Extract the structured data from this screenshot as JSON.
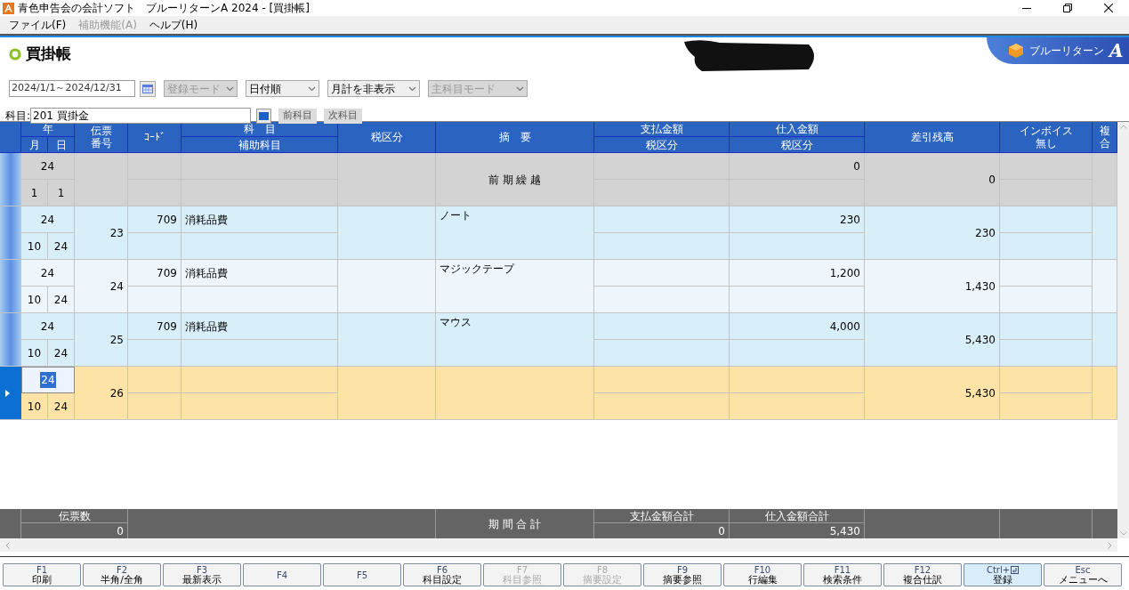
{
  "window": {
    "title": "青色申告会の会計ソフト　ブルーリターンA 2024 - [買掛帳]"
  },
  "menu": [
    {
      "label": "ファイル(F)",
      "disabled": false
    },
    {
      "label": "補助機能(A)",
      "disabled": true
    },
    {
      "label": "ヘルプ(H)",
      "disabled": false
    }
  ],
  "page": {
    "title": "買掛帳"
  },
  "brand": {
    "name": "ブルーリターン",
    "mark": "A"
  },
  "filters": {
    "period": "2024/1/1～2024/12/31",
    "dropdowns": [
      {
        "value": "登録モード",
        "disabled": true
      },
      {
        "value": "日付順",
        "disabled": false
      },
      {
        "value": "月計を非表示",
        "disabled": false
      },
      {
        "value": "主科目モード",
        "disabled": true
      }
    ]
  },
  "account": {
    "label": "科目:",
    "value": "201 買掛金",
    "buttons": [
      "前科目",
      "次科目"
    ]
  },
  "table": {
    "headers": {
      "year": "年",
      "month": "月",
      "day": "日",
      "voucher": [
        "伝票",
        "番号"
      ],
      "code": "ｺｰﾄﾞ",
      "account": "科　目",
      "sub_account": "補助科目",
      "tax": "税区分",
      "memo": "摘　要",
      "payment": "支払金額",
      "payment_tax": "税区分",
      "purchase": "仕入金額",
      "purchase_tax": "税区分",
      "balance": "差引残高",
      "invoice": [
        "インボイス",
        "無し"
      ],
      "compound": [
        "複",
        "合"
      ]
    },
    "rows": [
      {
        "kind": "opening",
        "selected": false,
        "year": "24",
        "month": "1",
        "day": "1",
        "memo": "前 期 繰 越",
        "purchase": "0",
        "balance": "0"
      },
      {
        "kind": "entry",
        "selected": false,
        "year": "24",
        "month": "10",
        "day": "24",
        "voucher": "23",
        "code": "709",
        "account": "消耗品費",
        "memo": "ノート",
        "purchase": "230",
        "balance": "230"
      },
      {
        "kind": "entry",
        "selected": false,
        "year": "24",
        "month": "10",
        "day": "24",
        "voucher": "24",
        "code": "709",
        "account": "消耗品費",
        "memo": "マジックテープ",
        "purchase": "1,200",
        "balance": "1,430"
      },
      {
        "kind": "entry",
        "selected": false,
        "year": "24",
        "month": "10",
        "day": "24",
        "voucher": "25",
        "code": "709",
        "account": "消耗品費",
        "memo": "マウス",
        "purchase": "4,000",
        "balance": "5,430"
      },
      {
        "kind": "new",
        "selected": true,
        "year": "24",
        "month": "10",
        "day": "24",
        "voucher": "26",
        "balance": "5,430"
      }
    ],
    "totals": {
      "count_label": "伝票数",
      "count": "0",
      "period_label": "期 間 合 計",
      "payment_label": "支払金額合計",
      "payment": "0",
      "purchase_label": "仕入金額合計",
      "purchase": "5,430"
    }
  },
  "function_keys": [
    {
      "key": "F1",
      "label": "印刷",
      "disabled": false,
      "highlighted": false
    },
    {
      "key": "F2",
      "label": "半角/全角",
      "disabled": false,
      "highlighted": false
    },
    {
      "key": "F3",
      "label": "最新表示",
      "disabled": false,
      "highlighted": false
    },
    {
      "key": "F4",
      "disabled": false,
      "highlighted": false
    },
    {
      "key": "F5",
      "disabled": false,
      "highlighted": false
    },
    {
      "key": "F6",
      "label": "科目設定",
      "disabled": false,
      "highlighted": false
    },
    {
      "key": "F7",
      "label": "科目参照",
      "disabled": true,
      "highlighted": false
    },
    {
      "key": "F8",
      "label": "摘要設定",
      "disabled": true,
      "highlighted": false
    },
    {
      "key": "F9",
      "label": "摘要参照",
      "disabled": false,
      "highlighted": false
    },
    {
      "key": "F10",
      "label": "行編集",
      "disabled": false,
      "highlighted": false
    },
    {
      "key": "F11",
      "label": "検索条件",
      "disabled": false,
      "highlighted": false
    },
    {
      "key": "F12",
      "label": "複合仕訳",
      "disabled": false,
      "highlighted": false
    },
    {
      "key": "Ctrl+",
      "label": "登録",
      "disabled": false,
      "highlighted": true,
      "enter_icon": true
    },
    {
      "key": "Esc",
      "label": "メニューへ",
      "disabled": false,
      "highlighted": false
    }
  ]
}
